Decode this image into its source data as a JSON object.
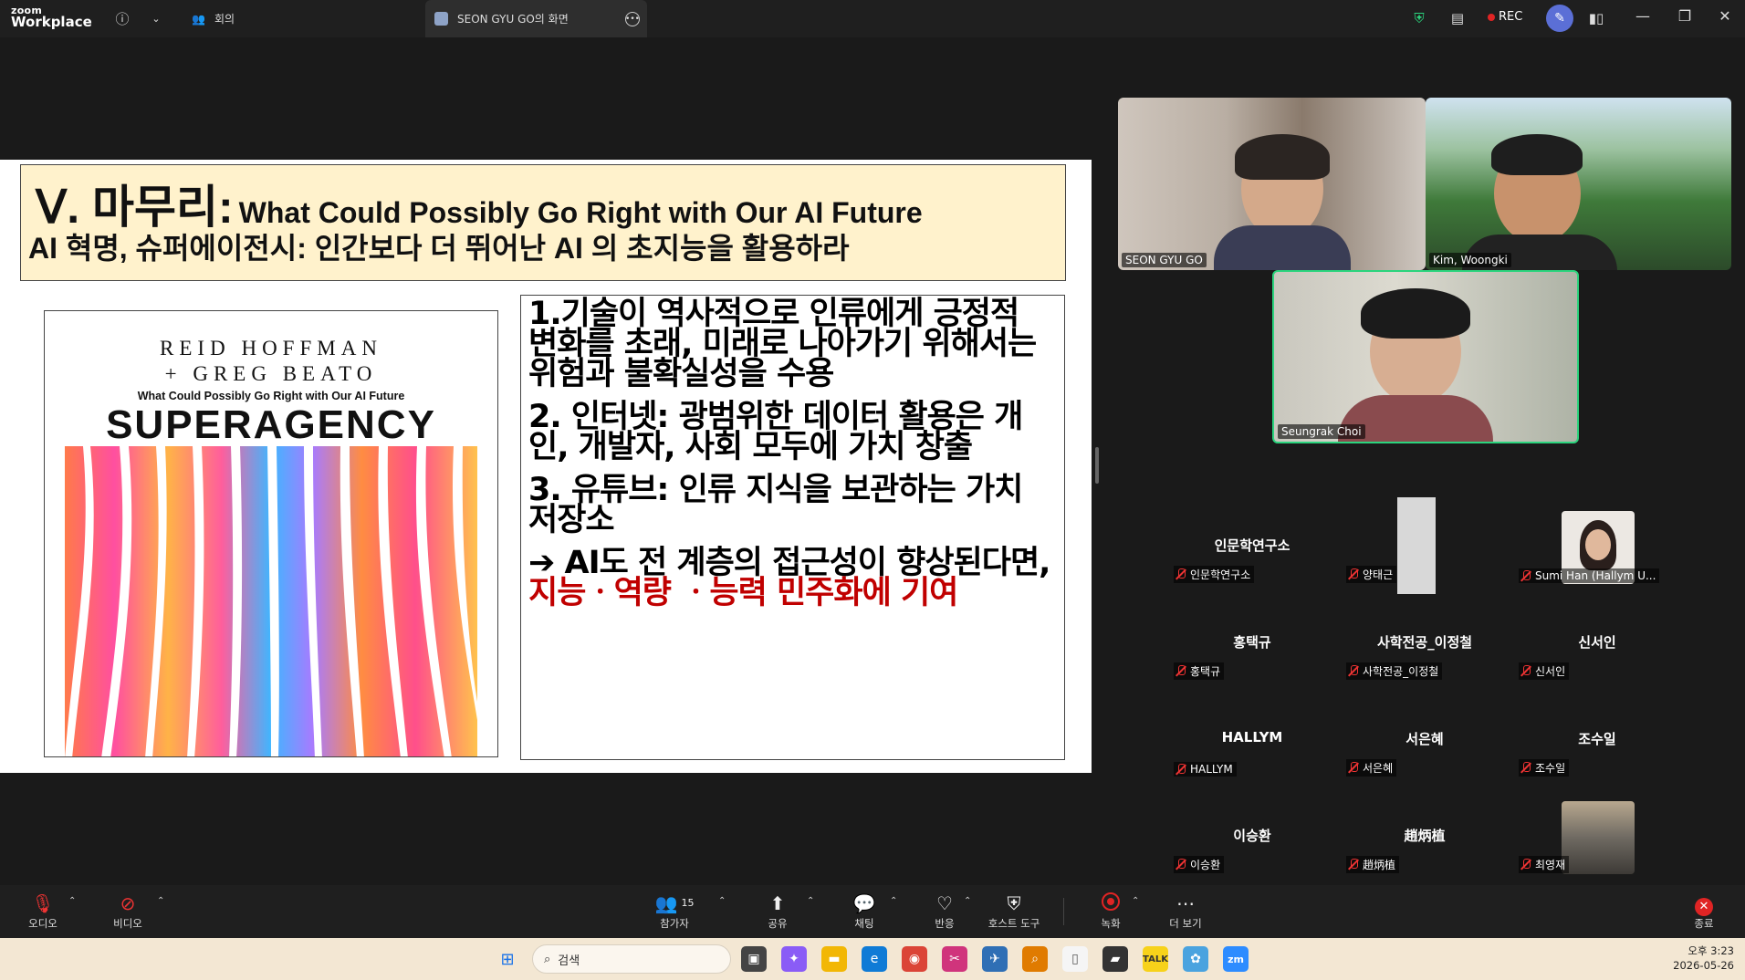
{
  "titlebar": {
    "brand_top": "zoom",
    "brand_bottom": "Workplace",
    "tab_meeting": "회의",
    "tab_share": "SEON GYU GO의 화면",
    "rec_label": "REC"
  },
  "slide": {
    "title_big": "Ⅴ. 마무리:",
    "title_en": "What Could Possibly Go Right with Our AI Future",
    "title_ko": "AI 혁명, 슈퍼에이전시: 인간보다 더 뛰어난 AI 의 초지능을 활용하라",
    "book": {
      "author1": "REID HOFFMAN",
      "author2": "+ GREG BEATO",
      "subtitle": "What Could Possibly Go Right with Our AI Future",
      "title": "SUPERAGENCY"
    },
    "points": [
      "1.기술이 역사적으로 인류에게 긍정적 변화를 초래, 미래로 나아가기 위해서는 위험과 불확실성을 수용",
      "2. 인터넷: 광범위한 데이터 활용은 개인, 개발자, 사회 모두에 가치 창출",
      "3. 유튜브: 인류 지식을 보관하는 가치 저장소"
    ],
    "conclusion_black": "➔ AI도 전 계층의 접근성이 향상된다면, ",
    "conclusion_red": "지능ㆍ역량 ㆍ능력 민주화에 기여"
  },
  "videos": [
    {
      "name": "SEON GYU GO"
    },
    {
      "name": "Kim, Woongki"
    },
    {
      "name": "Seungrak Choi"
    }
  ],
  "participants": [
    {
      "big": "인문학연구소",
      "label": "인문학연구소"
    },
    {
      "big": "",
      "label": "양태근"
    },
    {
      "big": "",
      "label": "Sumi Han (Hallym U..."
    },
    {
      "big": "홍택규",
      "label": "홍택규"
    },
    {
      "big": "사학전공_이정철",
      "label": "사학전공_이정철"
    },
    {
      "big": "신서인",
      "label": "신서인"
    },
    {
      "big": "HALLYM",
      "label": "HALLYM"
    },
    {
      "big": "서은혜",
      "label": "서은혜"
    },
    {
      "big": "조수일",
      "label": "조수일"
    },
    {
      "big": "이승환",
      "label": "이승환"
    },
    {
      "big": "趙炳植",
      "label": "趙炳植"
    },
    {
      "big": "",
      "label": "최영재"
    }
  ],
  "toolbar": {
    "audio": "오디오",
    "video": "비디오",
    "participants": "참가자",
    "participant_count": "15",
    "share": "공유",
    "chat": "채팅",
    "react": "반응",
    "host_tools": "호스트 도구",
    "record": "녹화",
    "more": "더 보기",
    "end": "종료"
  },
  "taskbar": {
    "search_placeholder": "검색",
    "time": "오후 3:23",
    "date": "2026-05-26"
  },
  "colors": {
    "accent_green": "#2bd47d",
    "rec_red": "#e02424",
    "title_bg": "#fff2cc",
    "conclusion_red": "#c00000"
  }
}
